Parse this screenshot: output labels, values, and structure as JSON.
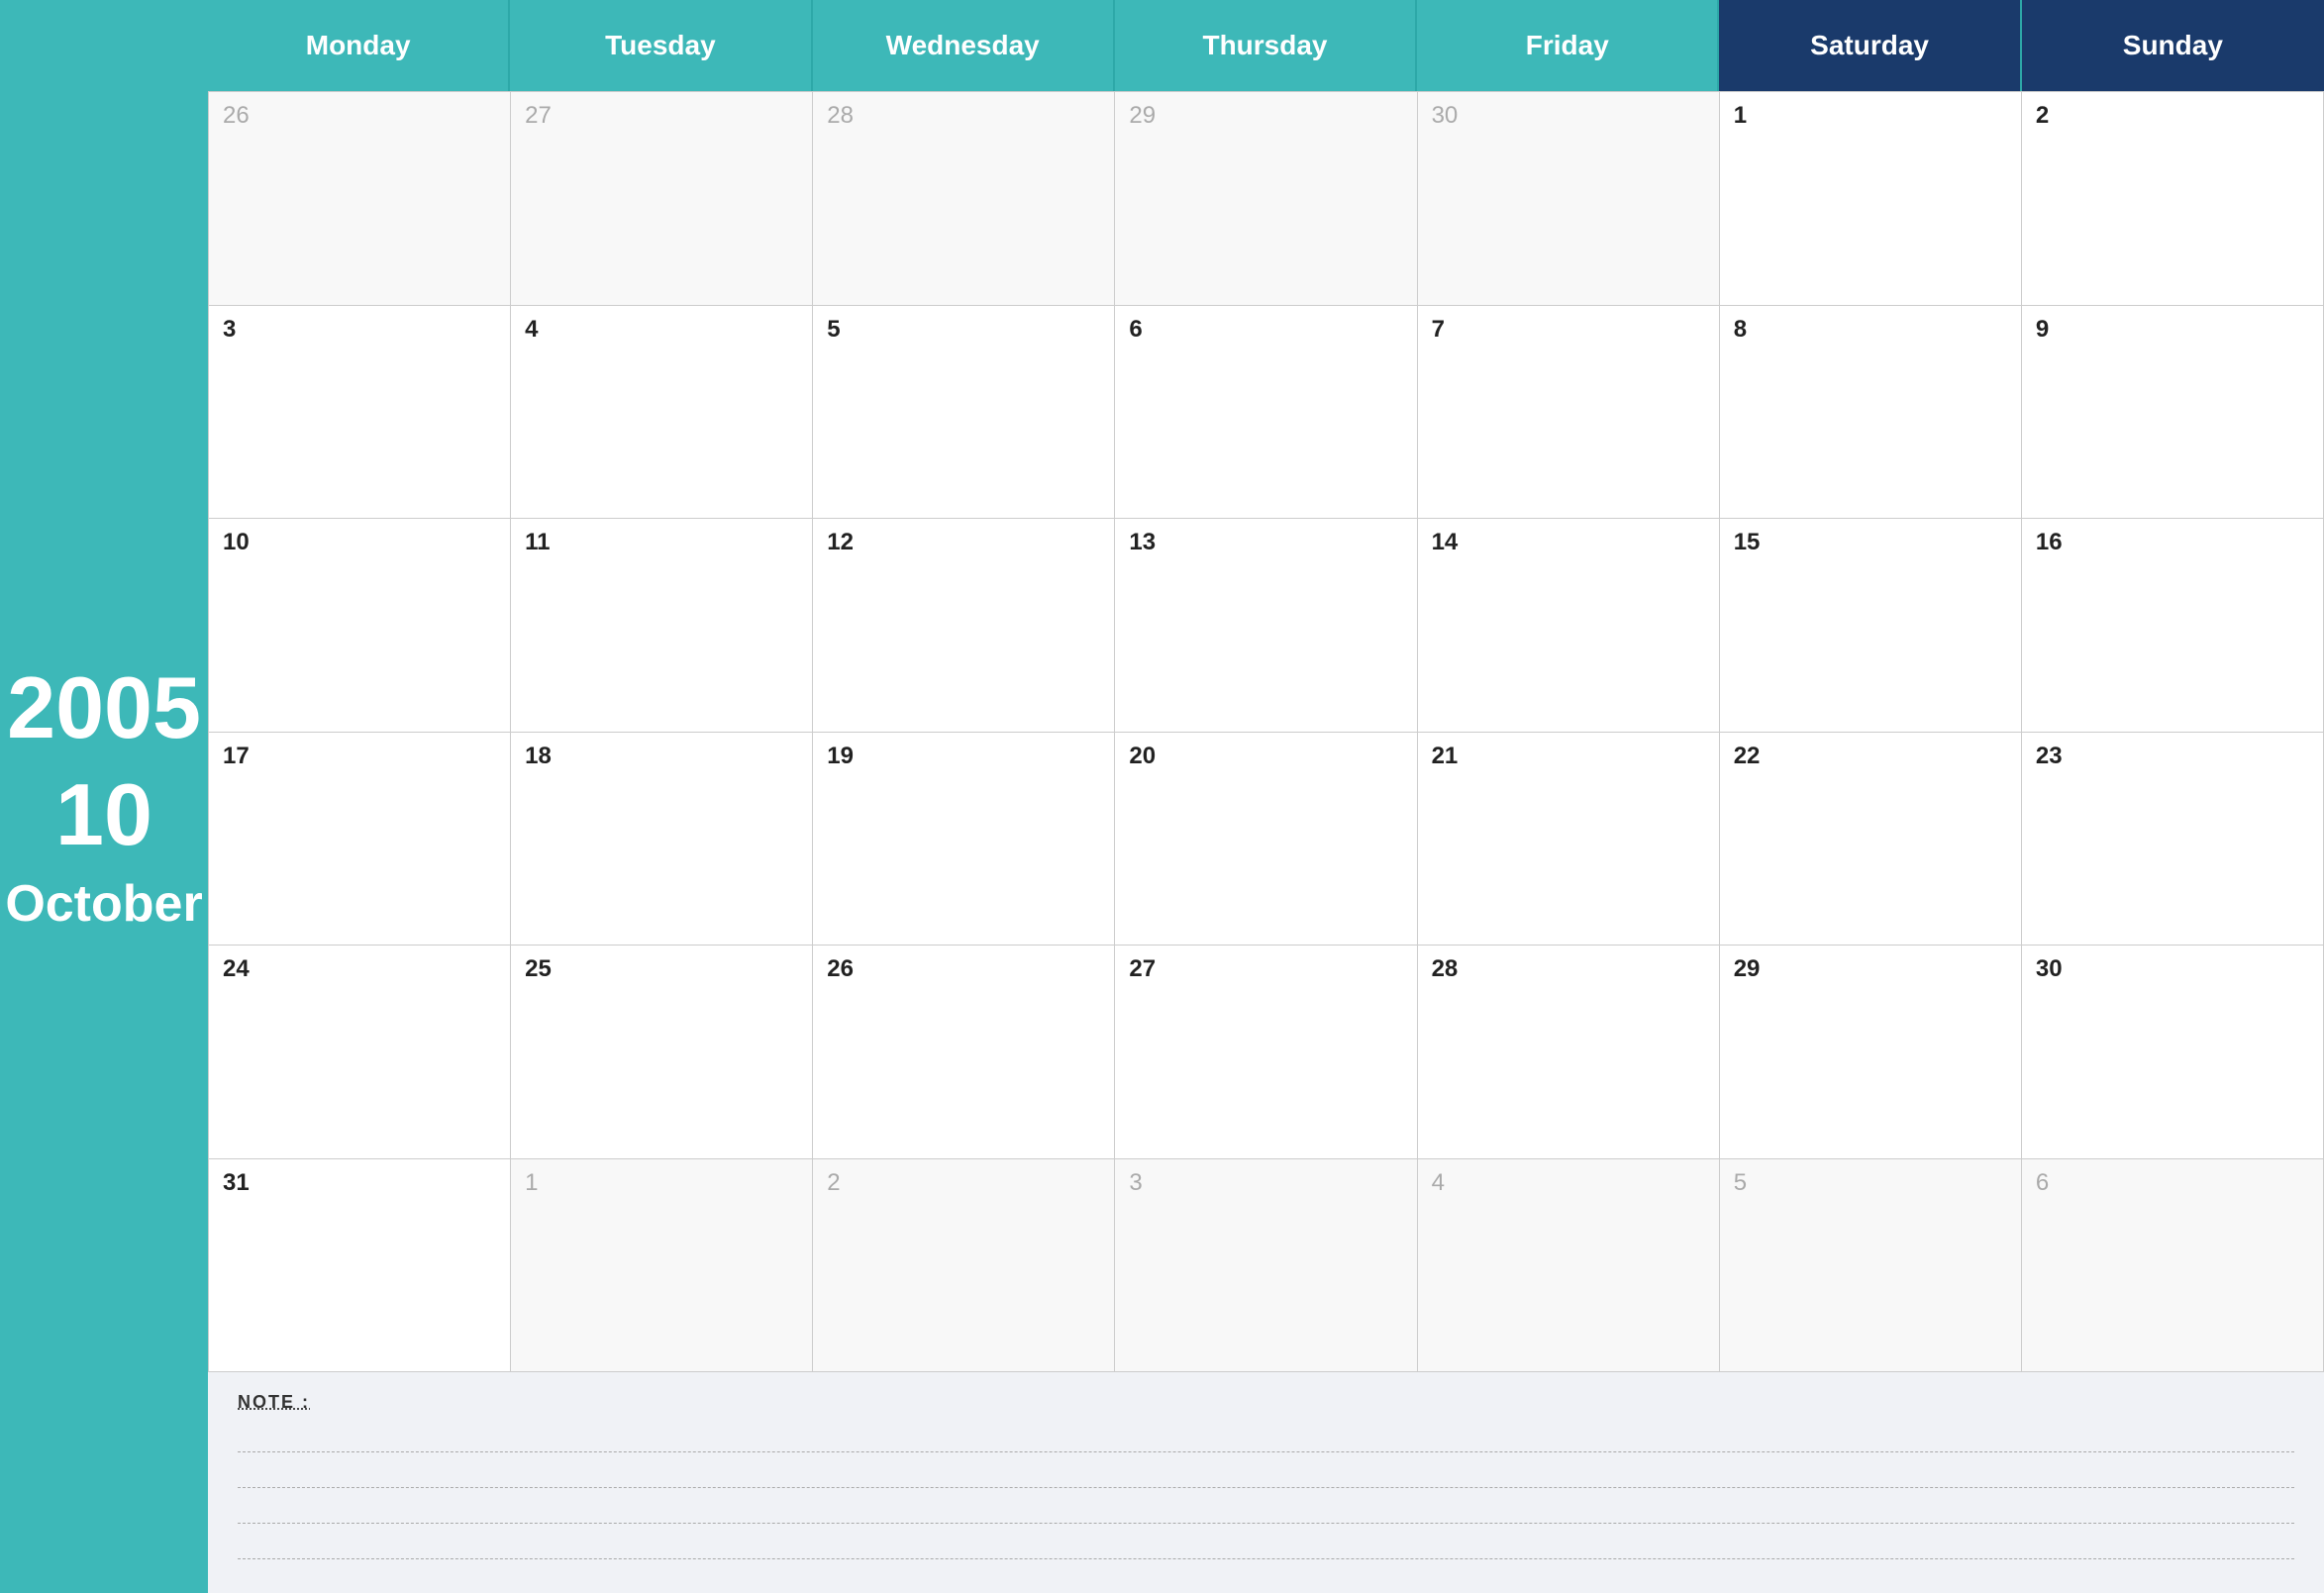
{
  "sidebar": {
    "year": "2005",
    "month_num": "10",
    "month_name": "October"
  },
  "header": {
    "days": [
      {
        "label": "Monday",
        "class": ""
      },
      {
        "label": "Tuesday",
        "class": ""
      },
      {
        "label": "Wednesday",
        "class": ""
      },
      {
        "label": "Thursday",
        "class": ""
      },
      {
        "label": "Friday",
        "class": ""
      },
      {
        "label": "Saturday",
        "class": "saturday"
      },
      {
        "label": "Sunday",
        "class": "sunday"
      }
    ]
  },
  "weeks": [
    [
      {
        "num": "26",
        "other": true
      },
      {
        "num": "27",
        "other": true
      },
      {
        "num": "28",
        "other": true
      },
      {
        "num": "29",
        "other": true
      },
      {
        "num": "30",
        "other": true
      },
      {
        "num": "1",
        "other": false
      },
      {
        "num": "2",
        "other": false
      }
    ],
    [
      {
        "num": "3",
        "other": false
      },
      {
        "num": "4",
        "other": false
      },
      {
        "num": "5",
        "other": false
      },
      {
        "num": "6",
        "other": false
      },
      {
        "num": "7",
        "other": false
      },
      {
        "num": "8",
        "other": false
      },
      {
        "num": "9",
        "other": false
      }
    ],
    [
      {
        "num": "10",
        "other": false
      },
      {
        "num": "11",
        "other": false
      },
      {
        "num": "12",
        "other": false
      },
      {
        "num": "13",
        "other": false
      },
      {
        "num": "14",
        "other": false
      },
      {
        "num": "15",
        "other": false
      },
      {
        "num": "16",
        "other": false
      }
    ],
    [
      {
        "num": "17",
        "other": false
      },
      {
        "num": "18",
        "other": false
      },
      {
        "num": "19",
        "other": false
      },
      {
        "num": "20",
        "other": false
      },
      {
        "num": "21",
        "other": false
      },
      {
        "num": "22",
        "other": false
      },
      {
        "num": "23",
        "other": false
      }
    ],
    [
      {
        "num": "24",
        "other": false
      },
      {
        "num": "25",
        "other": false
      },
      {
        "num": "26",
        "other": false
      },
      {
        "num": "27",
        "other": false
      },
      {
        "num": "28",
        "other": false
      },
      {
        "num": "29",
        "other": false
      },
      {
        "num": "30",
        "other": false
      }
    ],
    [
      {
        "num": "31",
        "other": false
      },
      {
        "num": "1",
        "other": true
      },
      {
        "num": "2",
        "other": true
      },
      {
        "num": "3",
        "other": true
      },
      {
        "num": "4",
        "other": true
      },
      {
        "num": "5",
        "other": true
      },
      {
        "num": "6",
        "other": true
      }
    ]
  ],
  "note": {
    "label": "NOTE :",
    "lines": 4
  },
  "colors": {
    "teal": "#3db8b8",
    "dark_blue": "#1a3a6b"
  }
}
